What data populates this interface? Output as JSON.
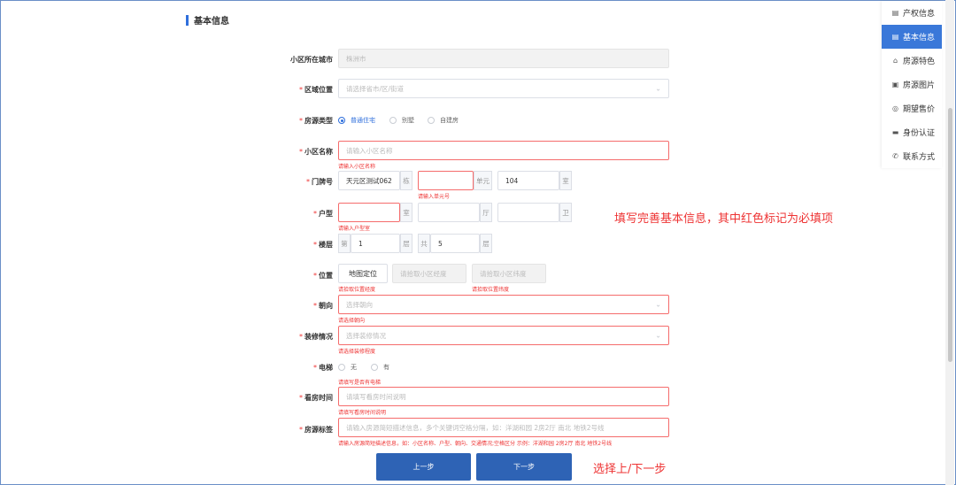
{
  "section_title": "基本信息",
  "fields": {
    "city": {
      "label": "小区所在城市",
      "value": "株洲市"
    },
    "area": {
      "label": "区域位置",
      "placeholder": "请选择省市/区/街道"
    },
    "type": {
      "label": "房源类型",
      "options": [
        "普通住宅",
        "别墅",
        "自建房"
      ],
      "selected": "普通住宅"
    },
    "community": {
      "label": "小区名称",
      "placeholder": "请输入小区名称",
      "error": "请输入小区名称"
    },
    "door": {
      "label": "门牌号",
      "building": "天元区测试062",
      "building_suffix": "栋",
      "unit_suffix": "单元",
      "room": "104",
      "room_suffix": "室",
      "error": "请输入单元号"
    },
    "layout": {
      "label": "户型",
      "s1": "室",
      "s2": "厅",
      "s3": "卫",
      "error": "请输入户型室"
    },
    "floor": {
      "label": "楼层",
      "prefix1": "第",
      "v1": "1",
      "s1": "层",
      "prefix2": "共",
      "v2": "5",
      "s2": "层"
    },
    "position": {
      "label": "位置",
      "map_btn": "地图定位",
      "lng_placeholder": "请拾取小区经度",
      "lat_placeholder": "请拾取小区纬度",
      "lng_error": "请拾取位置经度",
      "lat_error": "请拾取位置纬度"
    },
    "orientation": {
      "label": "朝向",
      "placeholder": "选择朝向",
      "error": "请选择朝向"
    },
    "decoration": {
      "label": "装修情况",
      "placeholder": "选择装修情况",
      "error": "请选择装修程度"
    },
    "elevator": {
      "label": "电梯",
      "options": [
        "无",
        "有"
      ],
      "error": "请填写是否有电梯"
    },
    "viewing": {
      "label": "看房时间",
      "placeholder": "请填写看房时间说明",
      "error": "请填写看房时间说明"
    },
    "tags": {
      "label": "房源标签",
      "placeholder": "请输入房源简短描述信息，多个关键词空格分隔，如：洋湖和园 2房2厅 南北 地铁2号线",
      "error": "请输入房源简短描述信息，如：小区名称、户型、朝向、交通情况;空格区分 示例：洋湖和园 2房2厅 南北 地铁2号线"
    }
  },
  "buttons": {
    "prev": "上一步",
    "next": "下一步"
  },
  "annotations": {
    "main": "填写完善基本信息，其中红色标记为必填项",
    "nav": "选择上/下一步"
  },
  "sidenav": [
    {
      "label": "产权信息",
      "icon": "document-icon"
    },
    {
      "label": "基本信息",
      "icon": "list-icon",
      "active": true
    },
    {
      "label": "房源特色",
      "icon": "home-icon"
    },
    {
      "label": "房源图片",
      "icon": "image-icon"
    },
    {
      "label": "期望售价",
      "icon": "price-icon"
    },
    {
      "label": "身份认证",
      "icon": "id-card-icon"
    },
    {
      "label": "联系方式",
      "icon": "phone-icon"
    }
  ],
  "colors": {
    "accent": "#2e63b5",
    "error": "#e33333",
    "active_nav": "#3a78d9"
  }
}
